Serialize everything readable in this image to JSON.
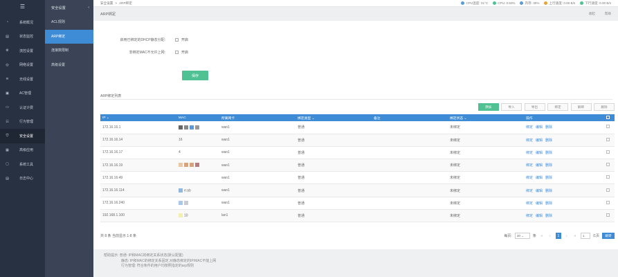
{
  "nav": {
    "items": [
      {
        "label": "系统概况",
        "icon": "dashboard-icon"
      },
      {
        "label": "状态监控",
        "icon": "monitor-icon"
      },
      {
        "label": "流控设置",
        "icon": "flow-control-icon"
      },
      {
        "label": "网络设置",
        "icon": "globe-icon"
      },
      {
        "label": "无线设置",
        "icon": "wifi-icon"
      },
      {
        "label": "AC管理",
        "icon": "ac-manage-icon"
      },
      {
        "label": "认证计费",
        "icon": "auth-icon"
      },
      {
        "label": "行为管理",
        "icon": "behavior-icon"
      },
      {
        "label": "安全设置",
        "icon": "shield-icon"
      },
      {
        "label": "高级应用",
        "icon": "advanced-icon"
      },
      {
        "label": "系统工具",
        "icon": "tools-icon"
      },
      {
        "label": "日志中心",
        "icon": "log-icon"
      }
    ]
  },
  "subnav": {
    "title": "安全设置",
    "items": [
      "ACL规则",
      "ARP绑定",
      "连接数限制",
      "高级设置"
    ]
  },
  "topbar": {
    "breadcrumb": [
      "安全设置",
      ">",
      "ARP绑定"
    ],
    "cpu_temp": "CPU温度: 31°C",
    "cpu": "CPU: 0.50%",
    "mem": "内存: 30%",
    "up": "上行速度: 0.00 B/s",
    "down": "下行速度: 0.00 B/s"
  },
  "panel": {
    "title": "ARP绑定",
    "collapse": "收起",
    "help": "帮助"
  },
  "form": {
    "dhcp_label": "启用已绑定的DHCP静态分配:",
    "dhcp_option": "开启",
    "mac_label": "非绑定MAC不允许上网:",
    "mac_option": "开启",
    "save": "保存"
  },
  "list": {
    "title": "ARP绑定列表",
    "buttons": [
      "添加",
      "导入",
      "导出",
      "绑定",
      "解绑",
      "删除"
    ],
    "columns": [
      "IP",
      "MAC",
      "所属网卡",
      "绑定类型",
      "备注",
      "绑定状态",
      "操作"
    ],
    "rows": [
      {
        "ip": "172.16.16.1",
        "mac_suffix": "",
        "iface": "wan1",
        "type": "普通",
        "note": "",
        "status": "未绑定"
      },
      {
        "ip": "172.16.16.14",
        "mac_suffix": "16",
        "iface": "wan1",
        "type": "普通",
        "note": "",
        "status": "未绑定"
      },
      {
        "ip": "172.16.16.17",
        "mac_suffix": "4",
        "iface": "wan1",
        "type": "普通",
        "note": "",
        "status": "未绑定"
      },
      {
        "ip": "172.16.16.19",
        "mac_suffix": "",
        "iface": "wan1",
        "type": "普通",
        "note": "",
        "status": "未绑定"
      },
      {
        "ip": "172.16.16.49",
        "mac_suffix": "",
        "iface": "wan1",
        "type": "普通",
        "note": "",
        "status": "未绑定"
      },
      {
        "ip": "172.16.16.114",
        "mac_suffix": "e:ab",
        "iface": "wan1",
        "type": "普通",
        "note": "",
        "status": "未绑定"
      },
      {
        "ip": "172.16.16.240",
        "mac_suffix": "",
        "iface": "wan1",
        "type": "普通",
        "note": "",
        "status": "未绑定"
      },
      {
        "ip": "192.168.1.100",
        "mac_suffix": "10",
        "iface": "lan1",
        "type": "普通",
        "note": "",
        "status": "未绑定"
      }
    ],
    "ops": [
      "绑定",
      "编辑",
      "删除"
    ]
  },
  "footer": {
    "summary": "共 8 条 当前显示 1-8 条",
    "per_page_label": "每页:",
    "per_page": "20",
    "unit": "条",
    "page": "1",
    "goto": "1",
    "total_pages": "/1页",
    "go": "跳转"
  },
  "tips": {
    "line1": "帮助提示: 普通: IP和MAC的绑定关系状态(默认配置)",
    "line2": "静态: IP和MAC的绑定关系固定,对静态绑定的IP/MAC不能上网",
    "line3": "行为管理: 符合条件的用户均按照指定的arp规则"
  },
  "colors": {
    "blue": "#3e8cd6",
    "green": "#4fc193",
    "red": "#e04848",
    "nav_bg": "#283142"
  }
}
